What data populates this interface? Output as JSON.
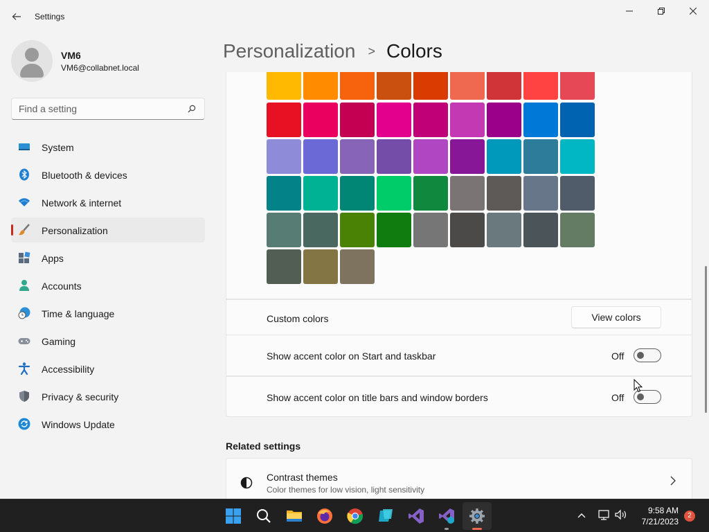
{
  "window": {
    "title": "Settings"
  },
  "profile": {
    "name": "VM6",
    "email": "VM6@collabnet.local"
  },
  "search": {
    "placeholder": "Find a setting"
  },
  "sidebar": {
    "items": [
      {
        "label": "System",
        "icon": "system-icon"
      },
      {
        "label": "Bluetooth & devices",
        "icon": "bluetooth-icon"
      },
      {
        "label": "Network & internet",
        "icon": "wifi-icon"
      },
      {
        "label": "Personalization",
        "icon": "paintbrush-icon",
        "selected": true
      },
      {
        "label": "Apps",
        "icon": "apps-icon"
      },
      {
        "label": "Accounts",
        "icon": "accounts-icon"
      },
      {
        "label": "Time & language",
        "icon": "globe-clock-icon"
      },
      {
        "label": "Gaming",
        "icon": "controller-icon"
      },
      {
        "label": "Accessibility",
        "icon": "accessibility-icon"
      },
      {
        "label": "Privacy & security",
        "icon": "shield-icon"
      },
      {
        "label": "Windows Update",
        "icon": "update-icon"
      }
    ]
  },
  "breadcrumb": {
    "parent": "Personalization",
    "separator": ">",
    "current": "Colors"
  },
  "palette": {
    "rows": [
      [
        "#FFB900",
        "#FF8C00",
        "#F7630C",
        "#CA5010",
        "#DA3B01",
        "#EF6950",
        "#D13438",
        "#FF4343",
        "#E74856"
      ],
      [
        "#E81123",
        "#EA005E",
        "#C30052",
        "#E3008C",
        "#BF0077",
        "#C239B3",
        "#9A0089",
        "#0078D7",
        "#0063B1"
      ],
      [
        "#8E8CD8",
        "#6B69D6",
        "#8764B8",
        "#744DA9",
        "#B146C2",
        "#881798",
        "#0099BC",
        "#2D7D9A",
        "#00B7C3"
      ],
      [
        "#038387",
        "#00B294",
        "#018574",
        "#00CC6A",
        "#10893E",
        "#7A7574",
        "#5D5A58",
        "#68768A",
        "#515C6B"
      ],
      [
        "#567C73",
        "#486860",
        "#498205",
        "#107C10",
        "#767676",
        "#4C4A48",
        "#69797E",
        "#4A5459",
        "#647C64"
      ],
      [
        "#525E54",
        "#847545",
        "#7E735F"
      ]
    ]
  },
  "custom_colors": {
    "label": "Custom colors",
    "button": "View colors"
  },
  "accent_start": {
    "label": "Show accent color on Start and taskbar",
    "state": "Off"
  },
  "accent_titlebars": {
    "label": "Show accent color on title bars and window borders",
    "state": "Off"
  },
  "related": {
    "title": "Related settings",
    "items": [
      {
        "title": "Contrast themes",
        "subtitle": "Color themes for low vision, light sensitivity",
        "icon": "contrast-icon"
      }
    ]
  },
  "taskbar": {
    "apps": [
      "start-icon",
      "search-icon",
      "file-explorer-icon",
      "firefox-icon",
      "chrome-icon",
      "azure-data-studio-icon",
      "visual-studio-icon",
      "visual-studio-preview-icon",
      "settings-icon"
    ],
    "time": "9:58 AM",
    "date": "7/21/2023",
    "notifications": "2"
  }
}
